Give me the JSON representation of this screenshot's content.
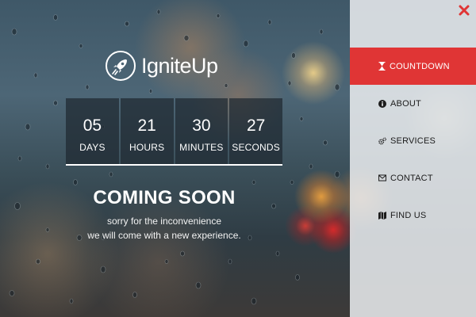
{
  "brand": {
    "name": "IgniteUp"
  },
  "countdown": [
    {
      "value": "05",
      "label": "DAYS"
    },
    {
      "value": "21",
      "label": "HOURS"
    },
    {
      "value": "30",
      "label": "MINUTES"
    },
    {
      "value": "27",
      "label": "SECONDS"
    }
  ],
  "headline": "COMING SOON",
  "subtitle_line1": "sorry for the inconvenience",
  "subtitle_line2": "we will come with a new experience.",
  "menu": {
    "close_icon": "close-x-icon",
    "accent_color": "#e03535",
    "items": [
      {
        "label": "COUNTDOWN",
        "icon": "hourglass-icon",
        "active": true
      },
      {
        "label": "ABOUT",
        "icon": "info-icon",
        "active": false
      },
      {
        "label": "SERVICES",
        "icon": "gears-icon",
        "active": false
      },
      {
        "label": "CONTACT",
        "icon": "envelope-icon",
        "active": false
      },
      {
        "label": "FIND US",
        "icon": "map-icon",
        "active": false
      }
    ]
  }
}
